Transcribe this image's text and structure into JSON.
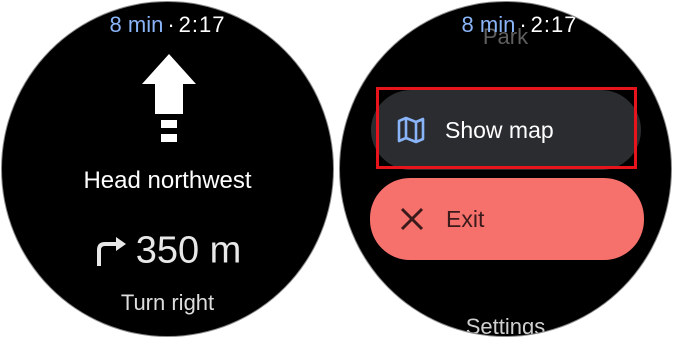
{
  "navigation": {
    "status": {
      "eta": "8 min",
      "separator": "·",
      "time": "2:17"
    },
    "maneuver_icon": "straight-arrow-icon",
    "instruction": "Head northwest",
    "next": {
      "icon": "turn-right-icon",
      "distance": "350 m",
      "label": "Turn right"
    }
  },
  "menu": {
    "status": {
      "eta": "8 min",
      "separator": "·",
      "time": "2:17"
    },
    "title": "Park",
    "items": [
      {
        "label": "Show map",
        "icon": "map-icon",
        "background": "#2a2c30",
        "icon_color": "#8ab4f8"
      },
      {
        "label": "Exit",
        "icon": "close-icon",
        "background": "#f7716c"
      }
    ],
    "settings_label": "Settings"
  },
  "colors": {
    "accent_blue": "#8ab4f8",
    "highlight_red": "#e8141c"
  }
}
